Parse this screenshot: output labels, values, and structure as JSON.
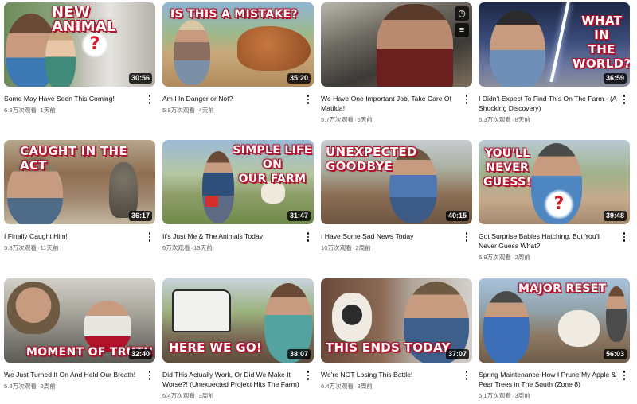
{
  "videos": [
    {
      "title": "Some May Have Seen This Coming!",
      "views": "6.3万次观看",
      "age": "1天前",
      "duration": "30:56",
      "overlay": "NEW ANIMAL",
      "thumb_desc": "couple-with-mystery-animal"
    },
    {
      "title": "Am I In Danger or Not?",
      "views": "5.8万次观看",
      "age": "4天前",
      "duration": "35:20",
      "overlay": "IS THIS A MISTAKE?",
      "thumb_desc": "man-and-running-horse"
    },
    {
      "title": "We Have One Important Job, Take Care Of Matilda!",
      "views": "5.7万次观看",
      "age": "6天前",
      "duration": "",
      "overlay": "",
      "thumb_desc": "man-in-workshop"
    },
    {
      "title": "I Didn't Expect To Find This On The Farm - (A Shocking Discovery)",
      "views": "6.3万次观看",
      "age": "8天前",
      "duration": "36:59",
      "overlay": "WHAT IN\nTHE\nWORLD?",
      "thumb_desc": "man-lightning-sky"
    },
    {
      "title": "I Finally Caught Him!",
      "views": "5.8万次观看",
      "age": "11天前",
      "duration": "36:17",
      "overlay": "CAUGHT IN THE ACT",
      "thumb_desc": "man-and-emu"
    },
    {
      "title": "It's Just Me & The Animals Today",
      "views": "6万次观看",
      "age": "13天前",
      "duration": "31:47",
      "overlay": "SIMPLE LIFE ON\nOUR FARM",
      "thumb_desc": "man-in-pasture"
    },
    {
      "title": "I Have Some Sad News Today",
      "views": "10万次观看",
      "age": "2周前",
      "duration": "40:15",
      "overlay": "UNEXPECTED\nGOODBYE",
      "thumb_desc": "man-sitting-log"
    },
    {
      "title": "Got Surprise Babies Hatching, But You'll Never Guess What?!",
      "views": "6.9万次观看",
      "age": "2周前",
      "duration": "39:48",
      "overlay": "YOU'LL\nNEVER\nGUESS!",
      "thumb_desc": "man-with-mystery-egg"
    },
    {
      "title": "We Just Turned It On And Held Our Breath!",
      "views": "5.8万次观看",
      "age": "2周前",
      "duration": "32:40",
      "overlay": "MOMENT OF TRUTH",
      "thumb_desc": "men-with-machine"
    },
    {
      "title": "Did This Actually Work, Or Did We Make It Worse?! (Unexpected Project Hits The Farm)",
      "views": "6.4万次观看",
      "age": "3周前",
      "duration": "38:07",
      "overlay": "HERE WE GO!",
      "thumb_desc": "man-with-skid-steer"
    },
    {
      "title": "We're NOT Losing This Battle!",
      "views": "6.4万次观看",
      "age": "3周前",
      "duration": "37:07",
      "overlay": "THIS ENDS TODAY",
      "thumb_desc": "man-with-goat"
    },
    {
      "title": "Spring Maintenance-How I Prune My Apple & Pear Trees in The South (Zone 8)",
      "views": "5.1万次观看",
      "age": "3周前",
      "duration": "56:03",
      "overlay": "MAJOR RESET",
      "thumb_desc": "men-pruning-trees"
    }
  ],
  "separator": "·",
  "overlay_icons": [
    "clock-icon",
    "queue-icon"
  ],
  "colors": {
    "text": "#0f0f0f",
    "secondary": "#606060",
    "overlay_outline": "#b3122b",
    "duration_bg": "#000000"
  }
}
